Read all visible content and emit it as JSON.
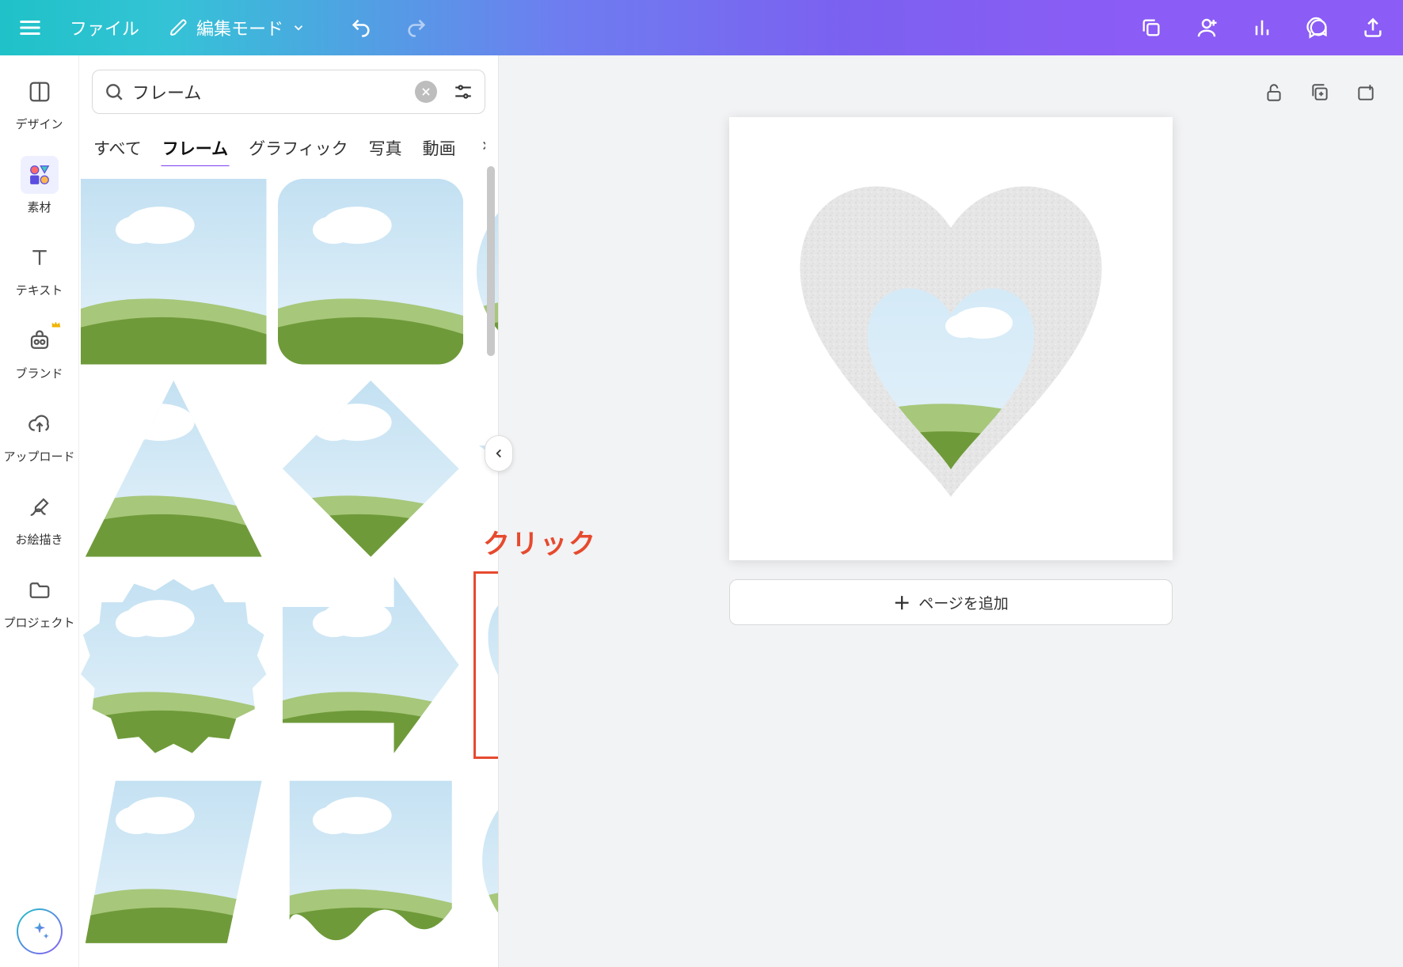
{
  "header": {
    "file_label": "ファイル",
    "mode_label": "編集モード"
  },
  "sidebar": {
    "items": [
      {
        "id": "design",
        "label": "デザイン"
      },
      {
        "id": "elements",
        "label": "素材",
        "active": true
      },
      {
        "id": "text",
        "label": "テキスト"
      },
      {
        "id": "brand",
        "label": "ブランド"
      },
      {
        "id": "uploads",
        "label": "アップロード"
      },
      {
        "id": "draw",
        "label": "お絵描き"
      },
      {
        "id": "projects",
        "label": "プロジェクト"
      }
    ]
  },
  "panel": {
    "search_value": "フレーム",
    "tabs": [
      {
        "id": "all",
        "label": "すべて"
      },
      {
        "id": "frames",
        "label": "フレーム",
        "active": true
      },
      {
        "id": "graphics",
        "label": "グラフィック"
      },
      {
        "id": "photos",
        "label": "写真"
      },
      {
        "id": "videos",
        "label": "動画"
      }
    ],
    "frames": [
      {
        "id": "square",
        "shape": "rect"
      },
      {
        "id": "rounded-square",
        "shape": "roundrect"
      },
      {
        "id": "circle",
        "shape": "circle"
      },
      {
        "id": "triangle",
        "shape": "triangle"
      },
      {
        "id": "diamond",
        "shape": "diamond"
      },
      {
        "id": "star",
        "shape": "star"
      },
      {
        "id": "badge",
        "shape": "badge"
      },
      {
        "id": "arrow-right",
        "shape": "arrow"
      },
      {
        "id": "heart",
        "shape": "heart",
        "highlight": true
      },
      {
        "id": "parallelogram",
        "shape": "parallelogram"
      },
      {
        "id": "wavy-rect",
        "shape": "wavy"
      },
      {
        "id": "blob",
        "shape": "blob"
      }
    ],
    "callout_text": "クリック"
  },
  "canvas": {
    "add_page_label": "ページを追加"
  },
  "colors": {
    "sky_top": "#c9e4f5",
    "sky_bottom": "#dff0f9",
    "cloud": "#ffffff",
    "hill_back": "#a7c77a",
    "hill_front": "#6f9a3a",
    "accent": "#e64a2e",
    "primary": "#7b3ff2"
  }
}
